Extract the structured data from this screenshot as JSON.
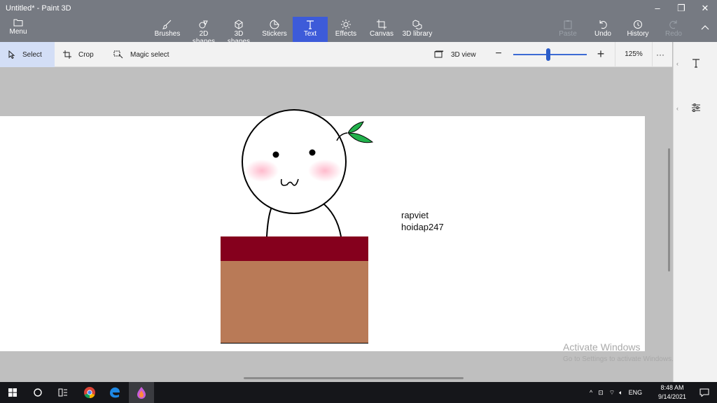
{
  "app": {
    "window_title": "Untitled* - Paint 3D"
  },
  "window_controls": {
    "minimize": "–",
    "restore": "❐",
    "close": "✕"
  },
  "ribbon": {
    "menu_label": "Menu",
    "tools": [
      {
        "label": "Brushes",
        "icon": "brush-icon"
      },
      {
        "label": "2D shapes",
        "icon": "2d-shapes-icon"
      },
      {
        "label": "3D shapes",
        "icon": "3d-shapes-icon"
      },
      {
        "label": "Stickers",
        "icon": "stickers-icon"
      },
      {
        "label": "Text",
        "icon": "text-icon",
        "active": true
      },
      {
        "label": "Effects",
        "icon": "effects-icon"
      },
      {
        "label": "Canvas",
        "icon": "canvas-icon"
      },
      {
        "label": "3D library",
        "icon": "3d-library-icon"
      }
    ],
    "paste": "Paste",
    "undo": "Undo",
    "history": "History",
    "redo": "Redo"
  },
  "command_bar": {
    "select": "Select",
    "crop": "Crop",
    "magic_select": "Magic select",
    "view_3d": "3D view",
    "zoom": "125%",
    "more": "···",
    "zoom_level_fraction": 0.48
  },
  "canvas": {
    "text_line1": "rapviet",
    "text_line2": "hoidap247",
    "box_top_color": "#85001d",
    "box_body_color": "#b97a57",
    "leaf_color": "#22b14c"
  },
  "watermark": {
    "title": "Activate Windows",
    "subtitle": "Go to Settings to activate Windows."
  },
  "taskbar": {
    "lang": "ENG",
    "time": "8:48 AM",
    "date": "9/14/2021"
  },
  "colors": {
    "title_bar": "#767a82",
    "accent": "#3d5bd9",
    "command_bar": "#f2f2f2"
  }
}
